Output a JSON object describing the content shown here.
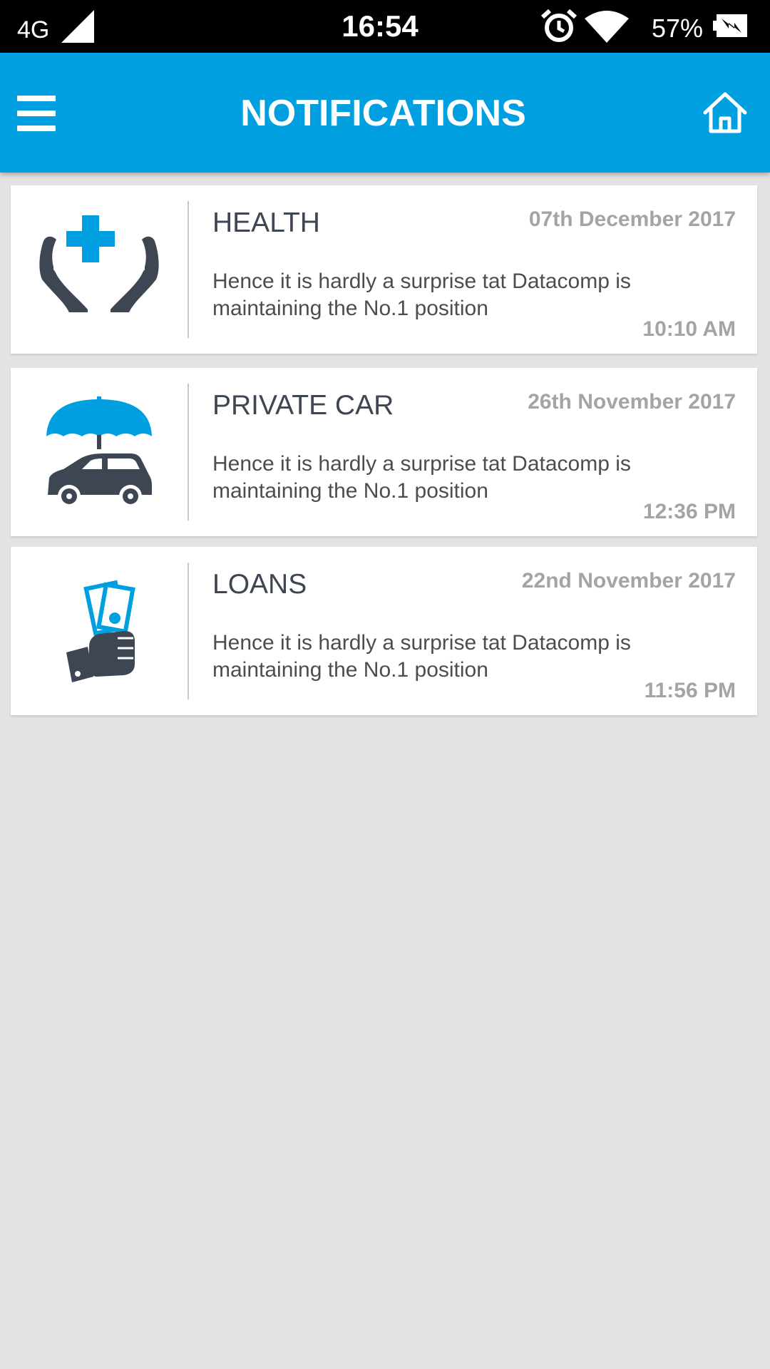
{
  "status_bar": {
    "network": "4G",
    "time": "16:54",
    "battery_percent": "57%"
  },
  "app_bar": {
    "title": "NOTIFICATIONS",
    "menu_icon": "hamburger-menu-icon",
    "home_icon": "home-icon"
  },
  "colors": {
    "accent": "#009fe0",
    "icon_dark": "#3e4553",
    "background": "#e3e3e3"
  },
  "notifications": [
    {
      "icon": "health-hands-cross-icon",
      "category": "HEALTH",
      "date": "07th December 2017",
      "message": "Hence it is hardly a surprise tat Datacomp is maintaining the No.1 position",
      "time": "10:10 AM"
    },
    {
      "icon": "car-umbrella-icon",
      "category": "PRIVATE CAR",
      "date": "26th November 2017",
      "message": "Hence it is hardly a surprise tat Datacomp is maintaining the No.1 position",
      "time": "12:36 PM"
    },
    {
      "icon": "hand-money-icon",
      "category": "LOANS",
      "date": "22nd November 2017",
      "message": "Hence it is hardly a surprise tat Datacomp is maintaining the No.1 position",
      "time": "11:56 PM"
    }
  ]
}
